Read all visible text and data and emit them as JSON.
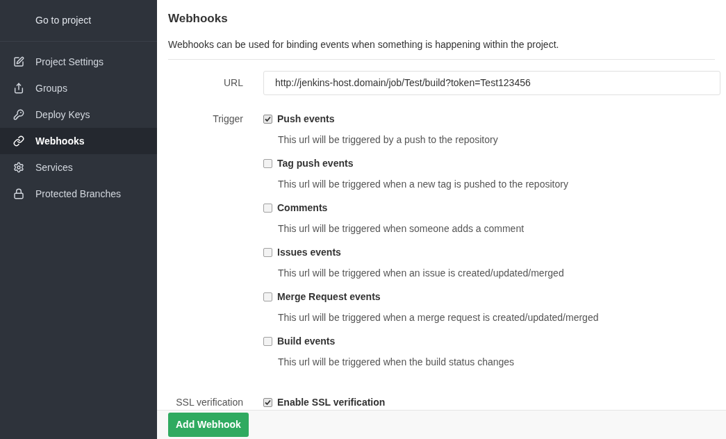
{
  "sidebar": {
    "header": "Go to project",
    "items": [
      {
        "kind": "edit",
        "label": "Project Settings",
        "selected": false
      },
      {
        "kind": "share",
        "label": "Groups",
        "selected": false
      },
      {
        "kind": "key",
        "label": "Deploy Keys",
        "selected": false
      },
      {
        "kind": "link",
        "label": "Webhooks",
        "selected": true
      },
      {
        "kind": "cogs",
        "label": "Services",
        "selected": false
      },
      {
        "kind": "lock",
        "label": "Protected Branches",
        "selected": false
      }
    ]
  },
  "page": {
    "title": "Webhooks",
    "description": "Webhooks can be used for binding events when something is happening within the project."
  },
  "form": {
    "url_label": "URL",
    "url_value": "http://jenkins-host.domain/job/Test/build?token=Test123456",
    "trigger_label": "Trigger",
    "triggers": [
      {
        "label": "Push events",
        "help": "This url will be triggered by a push to the repository",
        "checked": true
      },
      {
        "label": "Tag push events",
        "help": "This url will be triggered when a new tag is pushed to the repository",
        "checked": false
      },
      {
        "label": "Comments",
        "help": "This url will be triggered when someone adds a comment",
        "checked": false
      },
      {
        "label": "Issues events",
        "help": "This url will be triggered when an issue is created/updated/merged",
        "checked": false
      },
      {
        "label": "Merge Request events",
        "help": "This url will be triggered when a merge request is created/updated/merged",
        "checked": false
      },
      {
        "label": "Build events",
        "help": "This url will be triggered when the build status changes",
        "checked": false
      }
    ],
    "ssl_label": "SSL verification",
    "ssl_option": {
      "label": "Enable SSL verification",
      "checked": true
    }
  },
  "submit": "Add Webhook"
}
